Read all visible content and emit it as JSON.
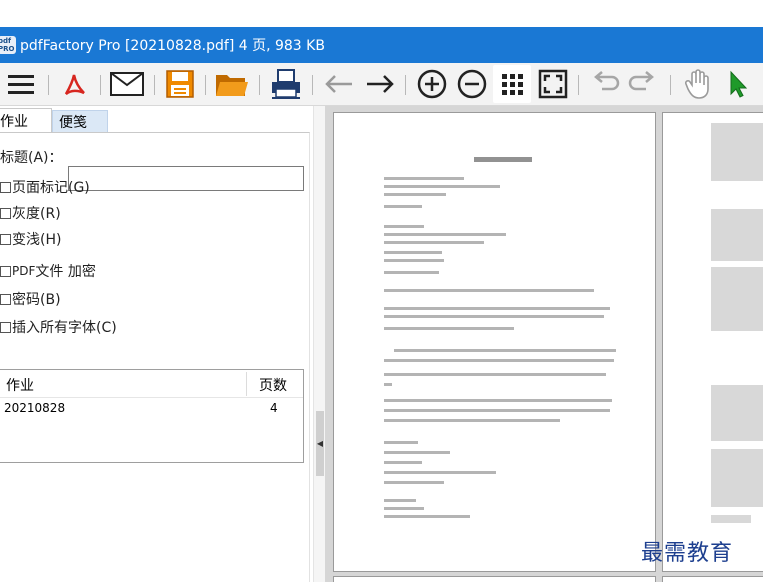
{
  "window": {
    "app_icon_text": "pdf PRO",
    "title": "pdfFactory Pro [20210828.pdf] 4 页, 983 KB"
  },
  "toolbar": {
    "icons": [
      "menu-icon",
      "acrobat-icon",
      "email-icon",
      "save-icon",
      "open-folder-icon",
      "print-icon",
      "back-arrow-icon",
      "forward-arrow-icon",
      "zoom-in-icon",
      "zoom-out-icon",
      "grid-view-icon",
      "fit-page-icon",
      "undo-icon",
      "redo-icon",
      "hand-tool-icon",
      "select-cursor-icon"
    ]
  },
  "tabs": [
    "作业",
    "便笺"
  ],
  "form": {
    "title_label": "标题(A)：",
    "title_value": "",
    "checkboxes": [
      {
        "label": "页面标记(G)",
        "checked": false
      },
      {
        "label": "灰度(R)",
        "checked": false
      },
      {
        "label": "变浅(H)",
        "checked": false
      },
      {
        "label_prefix": "PDF",
        "label": " 文件 加密",
        "checked": false
      },
      {
        "label": "密码(B)",
        "checked": false
      },
      {
        "label": "插入所有字体(C)",
        "checked": false
      }
    ]
  },
  "jobs": {
    "columns": [
      "作业",
      "页数"
    ],
    "rows": [
      {
        "name": "20210828",
        "pages": "4"
      }
    ]
  },
  "watermark": "最需教育",
  "colors": {
    "titlebar": "#1a78d4",
    "acrobat_red": "#d7261f",
    "save_orange": "#f08a00",
    "cursor_green": "#1f9a2a"
  }
}
